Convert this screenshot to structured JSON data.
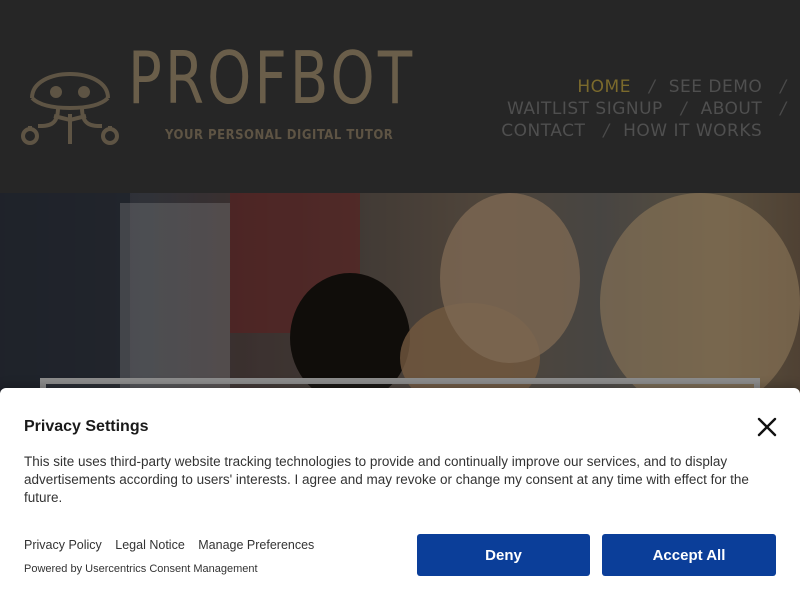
{
  "brand": {
    "name": "PROFBOT",
    "tagline": "YOUR PERSONAL DIGITAL TUTOR",
    "icon": "robot-book-logo"
  },
  "nav": {
    "rows": [
      [
        {
          "label": "HOME",
          "active": true
        },
        {
          "label": "SEE DEMO",
          "active": false
        }
      ],
      [
        {
          "label": "WAITLIST SIGNUP",
          "active": false
        },
        {
          "label": "ABOUT",
          "active": false
        }
      ],
      [
        {
          "label": "CONTACT",
          "active": false
        },
        {
          "label": "HOW IT WORKS",
          "active": false
        }
      ]
    ],
    "separator": "/"
  },
  "hero": {
    "image": "students-studying-photo"
  },
  "consent": {
    "title": "Privacy Settings",
    "text": "This site uses third-party website tracking technologies to provide and continually improve our services, and to display advertisements according to users' interests. I agree and may revoke or change my consent at any time with effect for the future.",
    "links": [
      "Privacy Policy",
      "Legal Notice",
      "Manage Preferences"
    ],
    "powered_by": "Powered by Usercentrics Consent Management",
    "deny_label": "Deny",
    "accept_label": "Accept All",
    "close_icon": "close-icon",
    "button_color": "#0b3e99"
  },
  "colors": {
    "header_bg": "#262626",
    "active_nav": "#7b6a2c",
    "nav_text": "#4f4f4f",
    "logo": "#6a5e4a"
  }
}
